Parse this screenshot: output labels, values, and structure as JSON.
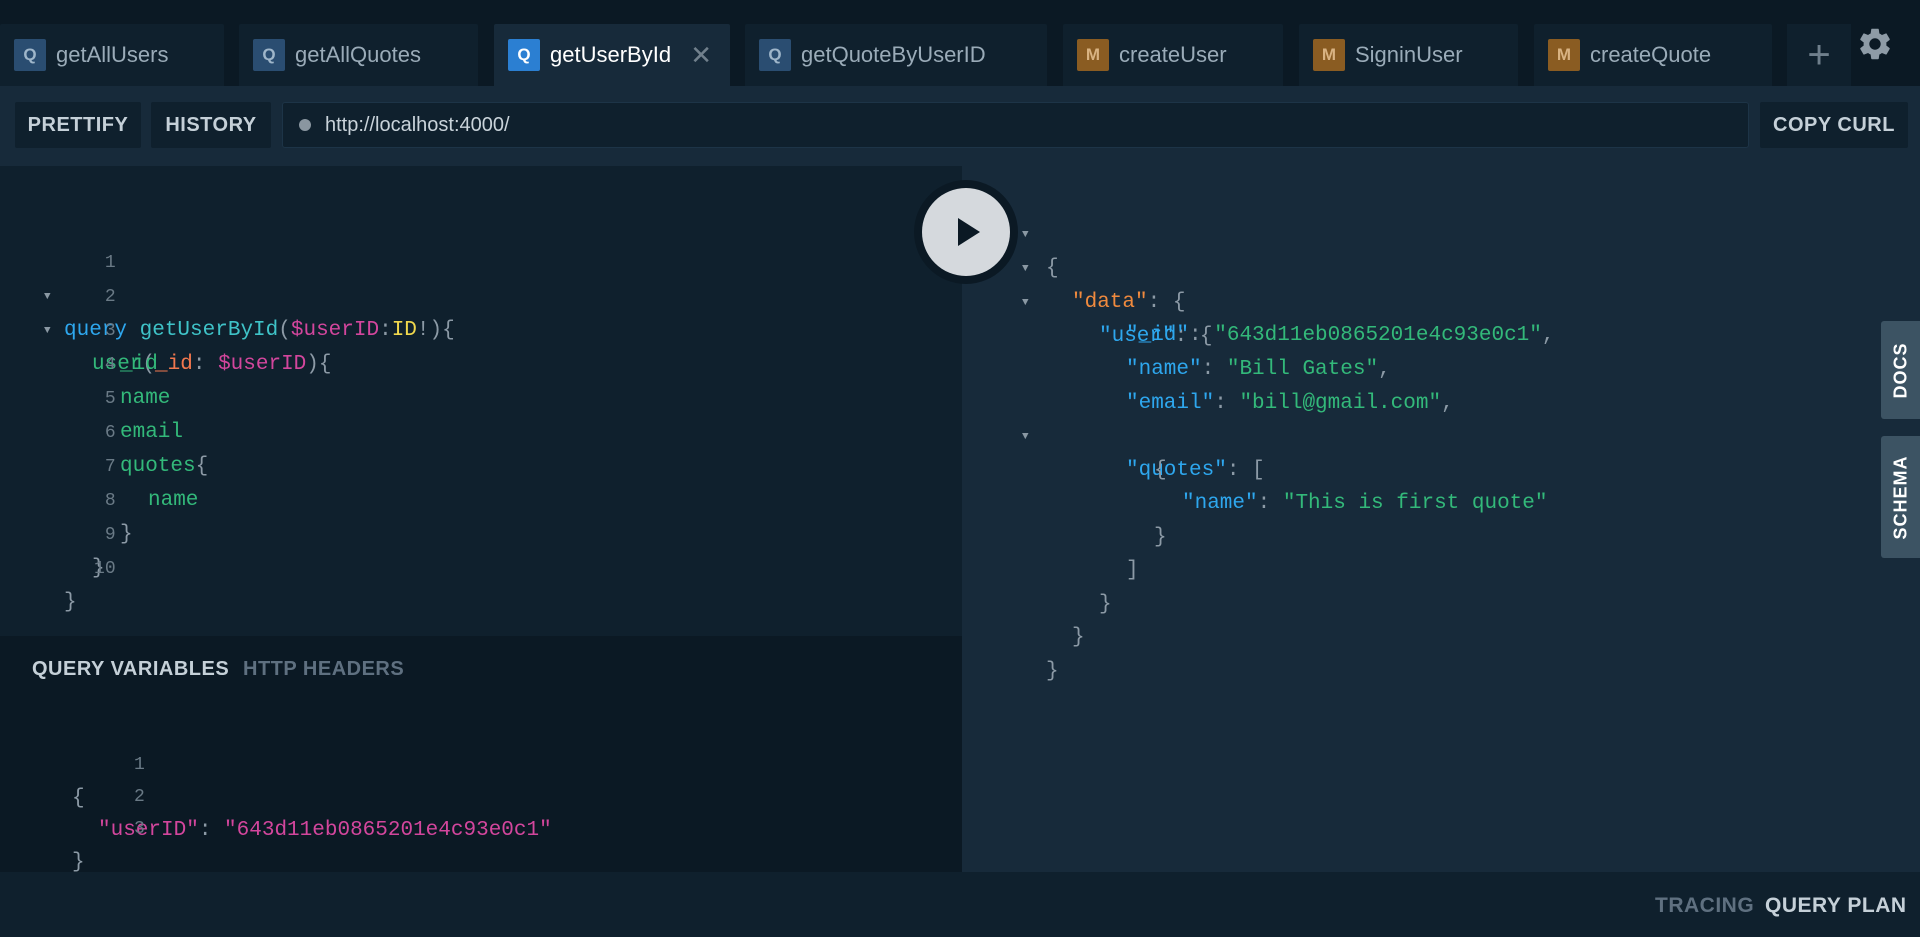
{
  "tabs": [
    {
      "badge": "Q",
      "label": "getAllUsers"
    },
    {
      "badge": "Q",
      "label": "getAllQuotes"
    },
    {
      "badge": "Q",
      "label": "getUserById",
      "close": "✕"
    },
    {
      "badge": "Q",
      "label": "getQuoteByUserID"
    },
    {
      "badge": "M",
      "label": "createUser"
    },
    {
      "badge": "M",
      "label": "SigninUser"
    },
    {
      "badge": "M",
      "label": "createQuote"
    }
  ],
  "add_tab_label": "+",
  "toolbar": {
    "prettify_label": "PRETTIFY",
    "history_label": "HISTORY",
    "url": "http://localhost:4000/",
    "copy_curl_label": "COPY CURL"
  },
  "editor": {
    "line_numbers": [
      "1",
      "2",
      "3",
      "4",
      "5",
      "6",
      "7",
      "8",
      "9",
      "10"
    ],
    "l1": {
      "kw": "query",
      "fn": "getUserById",
      "p1": "(",
      "var": "$userID",
      "colon": ":",
      "type": "ID",
      "p2": "!){"
    },
    "l2": {
      "field": "user",
      "p1": "(",
      "arg": "_id",
      "colon": ":",
      "var": "$userID",
      "p2": "){"
    },
    "l3": "_id",
    "l4": "name",
    "l5": "email",
    "l6": {
      "field": "quotes",
      "p": "{"
    },
    "l7": "name",
    "l8": "}",
    "l9": "}",
    "l10": "}"
  },
  "variables": {
    "tab_active": "QUERY VARIABLES",
    "tab_inactive": "HTTP HEADERS",
    "line_numbers": [
      "1",
      "2",
      "3"
    ],
    "open": "{",
    "key": "\"userID\"",
    "colon": ":",
    "value": "\"643d11eb0865201e4c93e0c1\"",
    "close": "}"
  },
  "result": {
    "open": "{",
    "data_key": "\"data\"",
    "user_key": "\"user\"",
    "id_key": "\"_id\"",
    "id_value": "\"643d11eb0865201e4c93e0c1\"",
    "name_key": "\"name\"",
    "name_value": "\"Bill Gates\"",
    "email_key": "\"email\"",
    "email_value": "\"bill@gmail.com\"",
    "quotes_key": "\"quotes\"",
    "quote_name_key": "\"name\"",
    "quote_name_value": "\"This is first quote\"",
    "colon_brace": ": {",
    "colon": ": ",
    "comma": ",",
    "colon_bracket": ": [",
    "brace_open": "{",
    "brace_close": "}",
    "bracket_close": "]"
  },
  "side_tabs": {
    "docs": "DOCS",
    "schema": "SCHEMA"
  },
  "footer": {
    "tracing": "TRACING",
    "query_plan": "QUERY PLAN"
  },
  "colors": {
    "background": "#0f202d",
    "panel": "#172a3a",
    "query_badge": "#2b7fd2",
    "mutation_badge": "#8a5c22"
  }
}
